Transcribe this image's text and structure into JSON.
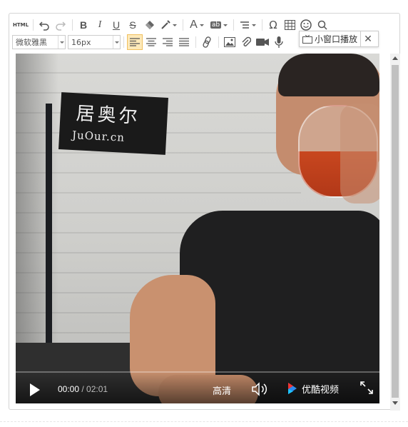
{
  "toolbar": {
    "html_label": "HTML",
    "font_family": "微软雅黑",
    "font_size": "16px",
    "active_align": "left"
  },
  "popup": {
    "pip_label": "小窗口播放",
    "close_label": "✕"
  },
  "video": {
    "sign_cn": "居奥尔",
    "sign_en": "JuOur.cn",
    "current_time": "00:00",
    "separator": " / ",
    "duration": "02:01",
    "quality": "高清",
    "brand": "优酷视频",
    "progress": 0
  },
  "icons": [
    "undo-icon",
    "redo-icon",
    "bold-icon",
    "italic-icon",
    "underline-icon",
    "strikethrough-icon",
    "eraser-icon",
    "format-painter-icon",
    "font-color-icon",
    "background-color-icon",
    "line-height-icon",
    "special-char-icon",
    "table-icon",
    "emoji-icon",
    "search-replace-icon",
    "link-icon",
    "image-icon",
    "attachment-icon",
    "video-icon",
    "audio-icon",
    "tv-icon",
    "play-icon",
    "volume-icon",
    "youku-logo-icon",
    "fullscreen-icon"
  ]
}
